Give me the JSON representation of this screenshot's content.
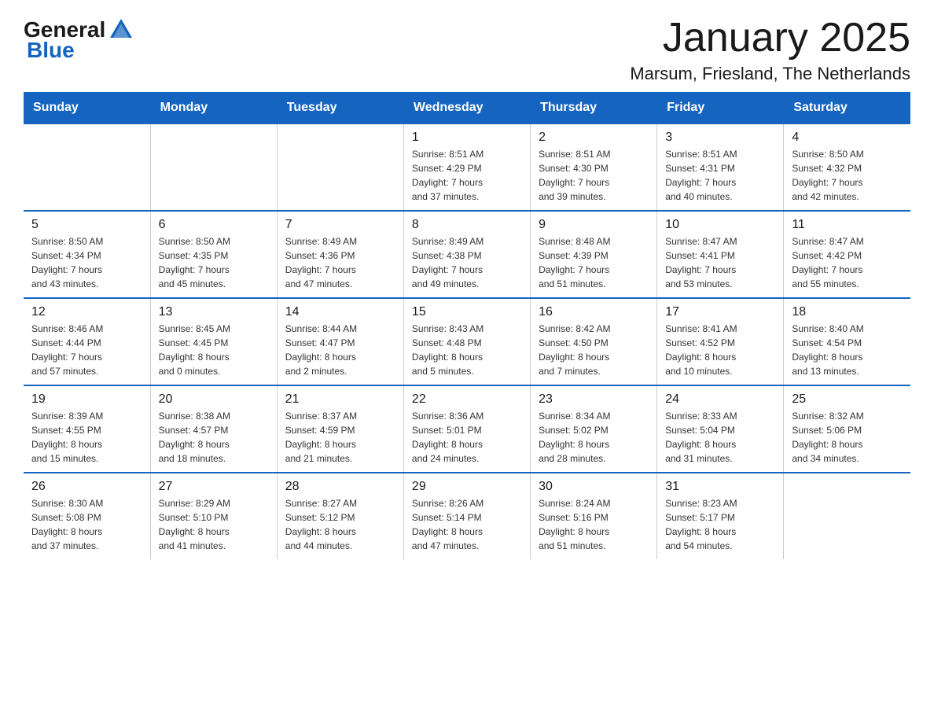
{
  "logo": {
    "text_general": "General",
    "text_blue": "Blue"
  },
  "title": "January 2025",
  "subtitle": "Marsum, Friesland, The Netherlands",
  "days_of_week": [
    "Sunday",
    "Monday",
    "Tuesday",
    "Wednesday",
    "Thursday",
    "Friday",
    "Saturday"
  ],
  "weeks": [
    [
      {
        "day": "",
        "info": ""
      },
      {
        "day": "",
        "info": ""
      },
      {
        "day": "",
        "info": ""
      },
      {
        "day": "1",
        "info": "Sunrise: 8:51 AM\nSunset: 4:29 PM\nDaylight: 7 hours\nand 37 minutes."
      },
      {
        "day": "2",
        "info": "Sunrise: 8:51 AM\nSunset: 4:30 PM\nDaylight: 7 hours\nand 39 minutes."
      },
      {
        "day": "3",
        "info": "Sunrise: 8:51 AM\nSunset: 4:31 PM\nDaylight: 7 hours\nand 40 minutes."
      },
      {
        "day": "4",
        "info": "Sunrise: 8:50 AM\nSunset: 4:32 PM\nDaylight: 7 hours\nand 42 minutes."
      }
    ],
    [
      {
        "day": "5",
        "info": "Sunrise: 8:50 AM\nSunset: 4:34 PM\nDaylight: 7 hours\nand 43 minutes."
      },
      {
        "day": "6",
        "info": "Sunrise: 8:50 AM\nSunset: 4:35 PM\nDaylight: 7 hours\nand 45 minutes."
      },
      {
        "day": "7",
        "info": "Sunrise: 8:49 AM\nSunset: 4:36 PM\nDaylight: 7 hours\nand 47 minutes."
      },
      {
        "day": "8",
        "info": "Sunrise: 8:49 AM\nSunset: 4:38 PM\nDaylight: 7 hours\nand 49 minutes."
      },
      {
        "day": "9",
        "info": "Sunrise: 8:48 AM\nSunset: 4:39 PM\nDaylight: 7 hours\nand 51 minutes."
      },
      {
        "day": "10",
        "info": "Sunrise: 8:47 AM\nSunset: 4:41 PM\nDaylight: 7 hours\nand 53 minutes."
      },
      {
        "day": "11",
        "info": "Sunrise: 8:47 AM\nSunset: 4:42 PM\nDaylight: 7 hours\nand 55 minutes."
      }
    ],
    [
      {
        "day": "12",
        "info": "Sunrise: 8:46 AM\nSunset: 4:44 PM\nDaylight: 7 hours\nand 57 minutes."
      },
      {
        "day": "13",
        "info": "Sunrise: 8:45 AM\nSunset: 4:45 PM\nDaylight: 8 hours\nand 0 minutes."
      },
      {
        "day": "14",
        "info": "Sunrise: 8:44 AM\nSunset: 4:47 PM\nDaylight: 8 hours\nand 2 minutes."
      },
      {
        "day": "15",
        "info": "Sunrise: 8:43 AM\nSunset: 4:48 PM\nDaylight: 8 hours\nand 5 minutes."
      },
      {
        "day": "16",
        "info": "Sunrise: 8:42 AM\nSunset: 4:50 PM\nDaylight: 8 hours\nand 7 minutes."
      },
      {
        "day": "17",
        "info": "Sunrise: 8:41 AM\nSunset: 4:52 PM\nDaylight: 8 hours\nand 10 minutes."
      },
      {
        "day": "18",
        "info": "Sunrise: 8:40 AM\nSunset: 4:54 PM\nDaylight: 8 hours\nand 13 minutes."
      }
    ],
    [
      {
        "day": "19",
        "info": "Sunrise: 8:39 AM\nSunset: 4:55 PM\nDaylight: 8 hours\nand 15 minutes."
      },
      {
        "day": "20",
        "info": "Sunrise: 8:38 AM\nSunset: 4:57 PM\nDaylight: 8 hours\nand 18 minutes."
      },
      {
        "day": "21",
        "info": "Sunrise: 8:37 AM\nSunset: 4:59 PM\nDaylight: 8 hours\nand 21 minutes."
      },
      {
        "day": "22",
        "info": "Sunrise: 8:36 AM\nSunset: 5:01 PM\nDaylight: 8 hours\nand 24 minutes."
      },
      {
        "day": "23",
        "info": "Sunrise: 8:34 AM\nSunset: 5:02 PM\nDaylight: 8 hours\nand 28 minutes."
      },
      {
        "day": "24",
        "info": "Sunrise: 8:33 AM\nSunset: 5:04 PM\nDaylight: 8 hours\nand 31 minutes."
      },
      {
        "day": "25",
        "info": "Sunrise: 8:32 AM\nSunset: 5:06 PM\nDaylight: 8 hours\nand 34 minutes."
      }
    ],
    [
      {
        "day": "26",
        "info": "Sunrise: 8:30 AM\nSunset: 5:08 PM\nDaylight: 8 hours\nand 37 minutes."
      },
      {
        "day": "27",
        "info": "Sunrise: 8:29 AM\nSunset: 5:10 PM\nDaylight: 8 hours\nand 41 minutes."
      },
      {
        "day": "28",
        "info": "Sunrise: 8:27 AM\nSunset: 5:12 PM\nDaylight: 8 hours\nand 44 minutes."
      },
      {
        "day": "29",
        "info": "Sunrise: 8:26 AM\nSunset: 5:14 PM\nDaylight: 8 hours\nand 47 minutes."
      },
      {
        "day": "30",
        "info": "Sunrise: 8:24 AM\nSunset: 5:16 PM\nDaylight: 8 hours\nand 51 minutes."
      },
      {
        "day": "31",
        "info": "Sunrise: 8:23 AM\nSunset: 5:17 PM\nDaylight: 8 hours\nand 54 minutes."
      },
      {
        "day": "",
        "info": ""
      }
    ]
  ]
}
